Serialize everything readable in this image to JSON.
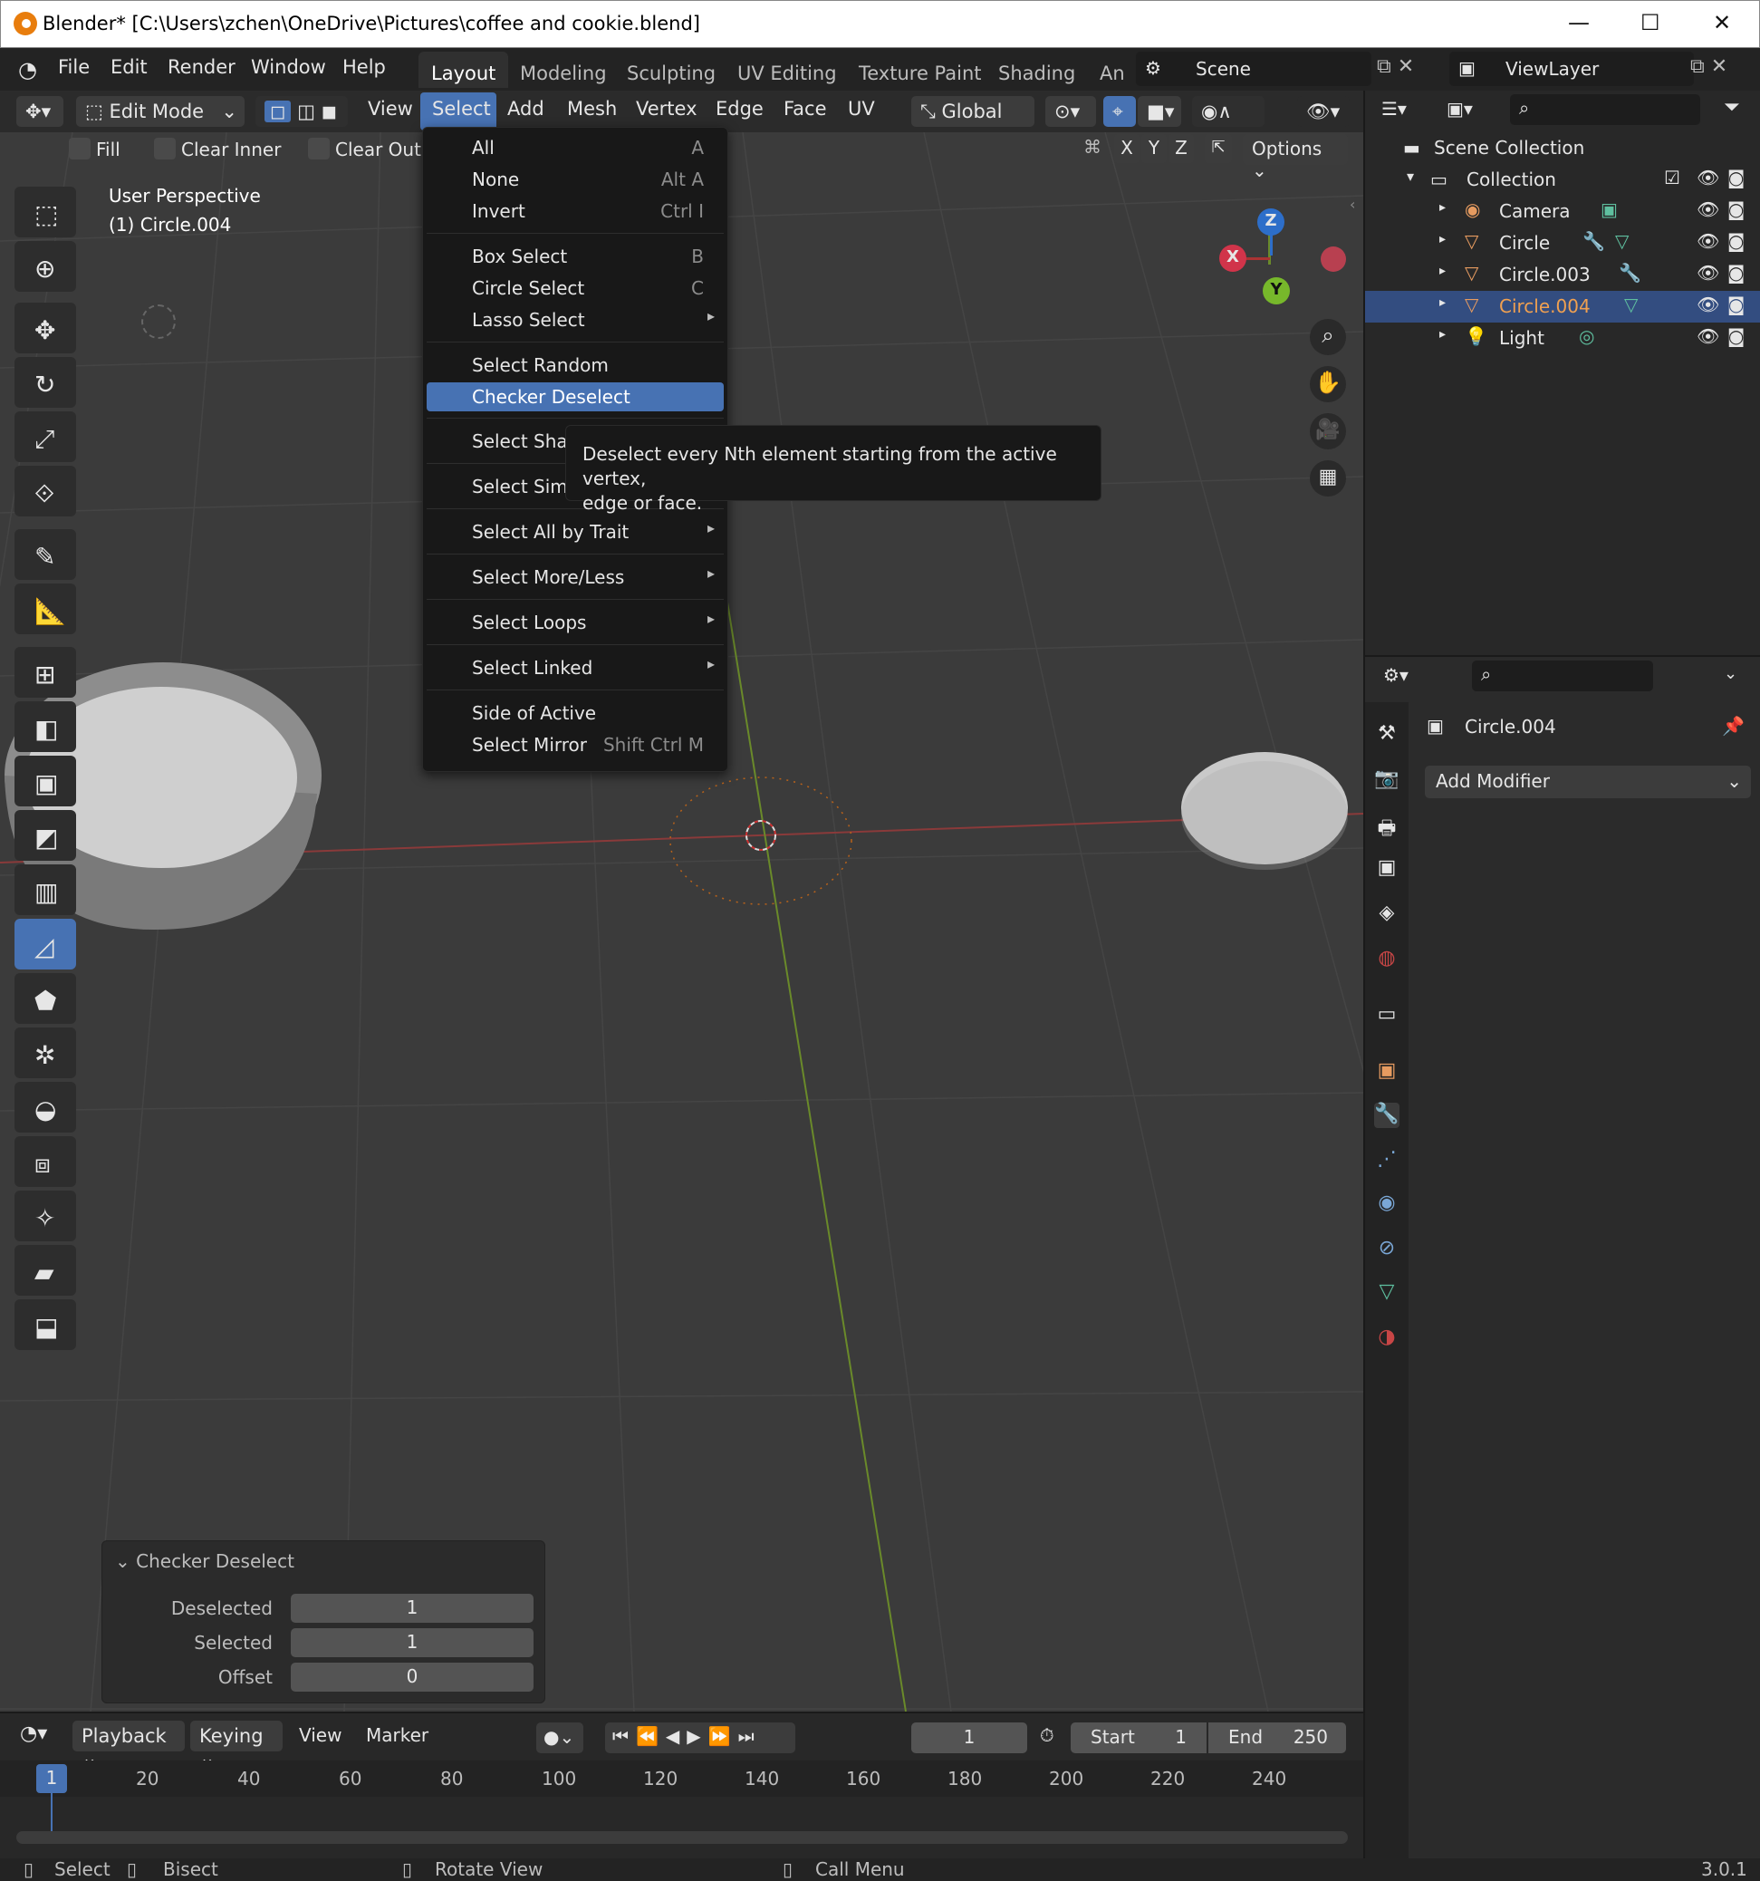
{
  "window": {
    "title": "Blender* [C:\\Users\\zchen\\OneDrive\\Pictures\\coffee and cookie.blend]",
    "min": "—",
    "max": "☐",
    "close": "✕"
  },
  "menubar": {
    "items": [
      "File",
      "Edit",
      "Render",
      "Window",
      "Help"
    ]
  },
  "workspaces": [
    "Layout",
    "Modeling",
    "Sculpting",
    "UV Editing",
    "Texture Paint",
    "Shading",
    "An"
  ],
  "scene": {
    "name": "Scene"
  },
  "viewlayer": {
    "name": "ViewLayer"
  },
  "viewport_header": {
    "mode": "Edit Mode",
    "menus": [
      "View",
      "Select",
      "Add",
      "Mesh",
      "Vertex",
      "Edge",
      "Face",
      "UV"
    ],
    "orientation": "Global"
  },
  "tool_options": {
    "fill": "Fill",
    "clear_inner": "Clear Inner",
    "clear_outer": "Clear Oute",
    "options": "Options",
    "axes": [
      "X",
      "Y",
      "Z"
    ]
  },
  "viewport": {
    "perspective": "User Perspective",
    "object": "(1) Circle.004"
  },
  "gizmo": {
    "x": "X",
    "y": "Y",
    "z": "Z"
  },
  "select_menu": {
    "items": [
      {
        "label": "All",
        "shortcut": "A"
      },
      {
        "label": "None",
        "shortcut": "Alt A"
      },
      {
        "label": "Invert",
        "shortcut": "Ctrl I"
      },
      {
        "label": "Box Select",
        "shortcut": "B"
      },
      {
        "label": "Circle Select",
        "shortcut": "C"
      },
      {
        "label": "Lasso Select",
        "shortcut": "▸"
      },
      {
        "label": "Select Random",
        "shortcut": ""
      },
      {
        "label": "Checker Deselect",
        "shortcut": ""
      },
      {
        "label": "Select Shar",
        "shortcut": ""
      },
      {
        "label": "Select Simi",
        "shortcut": ""
      },
      {
        "label": "Select All by Trait",
        "shortcut": "▸"
      },
      {
        "label": "Select More/Less",
        "shortcut": "▸"
      },
      {
        "label": "Select Loops",
        "shortcut": "▸"
      },
      {
        "label": "Select Linked",
        "shortcut": "▸"
      },
      {
        "label": "Side of Active",
        "shortcut": ""
      },
      {
        "label": "Select Mirror",
        "shortcut": "Shift Ctrl M"
      }
    ]
  },
  "tooltip": {
    "line1": "Deselect every Nth element starting from the active vertex,",
    "line2": "edge or face."
  },
  "outliner": {
    "root": "Scene Collection",
    "collection": "Collection",
    "objects": [
      "Camera",
      "Circle",
      "Circle.003",
      "Circle.004",
      "Light"
    ]
  },
  "properties": {
    "object": "Circle.004",
    "add_modifier": "Add Modifier"
  },
  "redo_panel": {
    "title": "Checker Deselect",
    "fields": [
      {
        "label": "Deselected",
        "value": "1"
      },
      {
        "label": "Selected",
        "value": "1"
      },
      {
        "label": "Offset",
        "value": "0"
      }
    ]
  },
  "timeline": {
    "menus": [
      "Playback",
      "Keying",
      "View",
      "Marker"
    ],
    "current_frame": "1",
    "start_label": "Start",
    "start": "1",
    "end_label": "End",
    "end": "250",
    "ruler": [
      "20",
      "40",
      "60",
      "80",
      "100",
      "120",
      "140",
      "160",
      "180",
      "200",
      "220",
      "240"
    ],
    "playhead": "1"
  },
  "statusbar": {
    "select": "Select",
    "bisect": "Bisect",
    "rotate": "Rotate View",
    "call_menu": "Call Menu",
    "version": "3.0.1"
  }
}
